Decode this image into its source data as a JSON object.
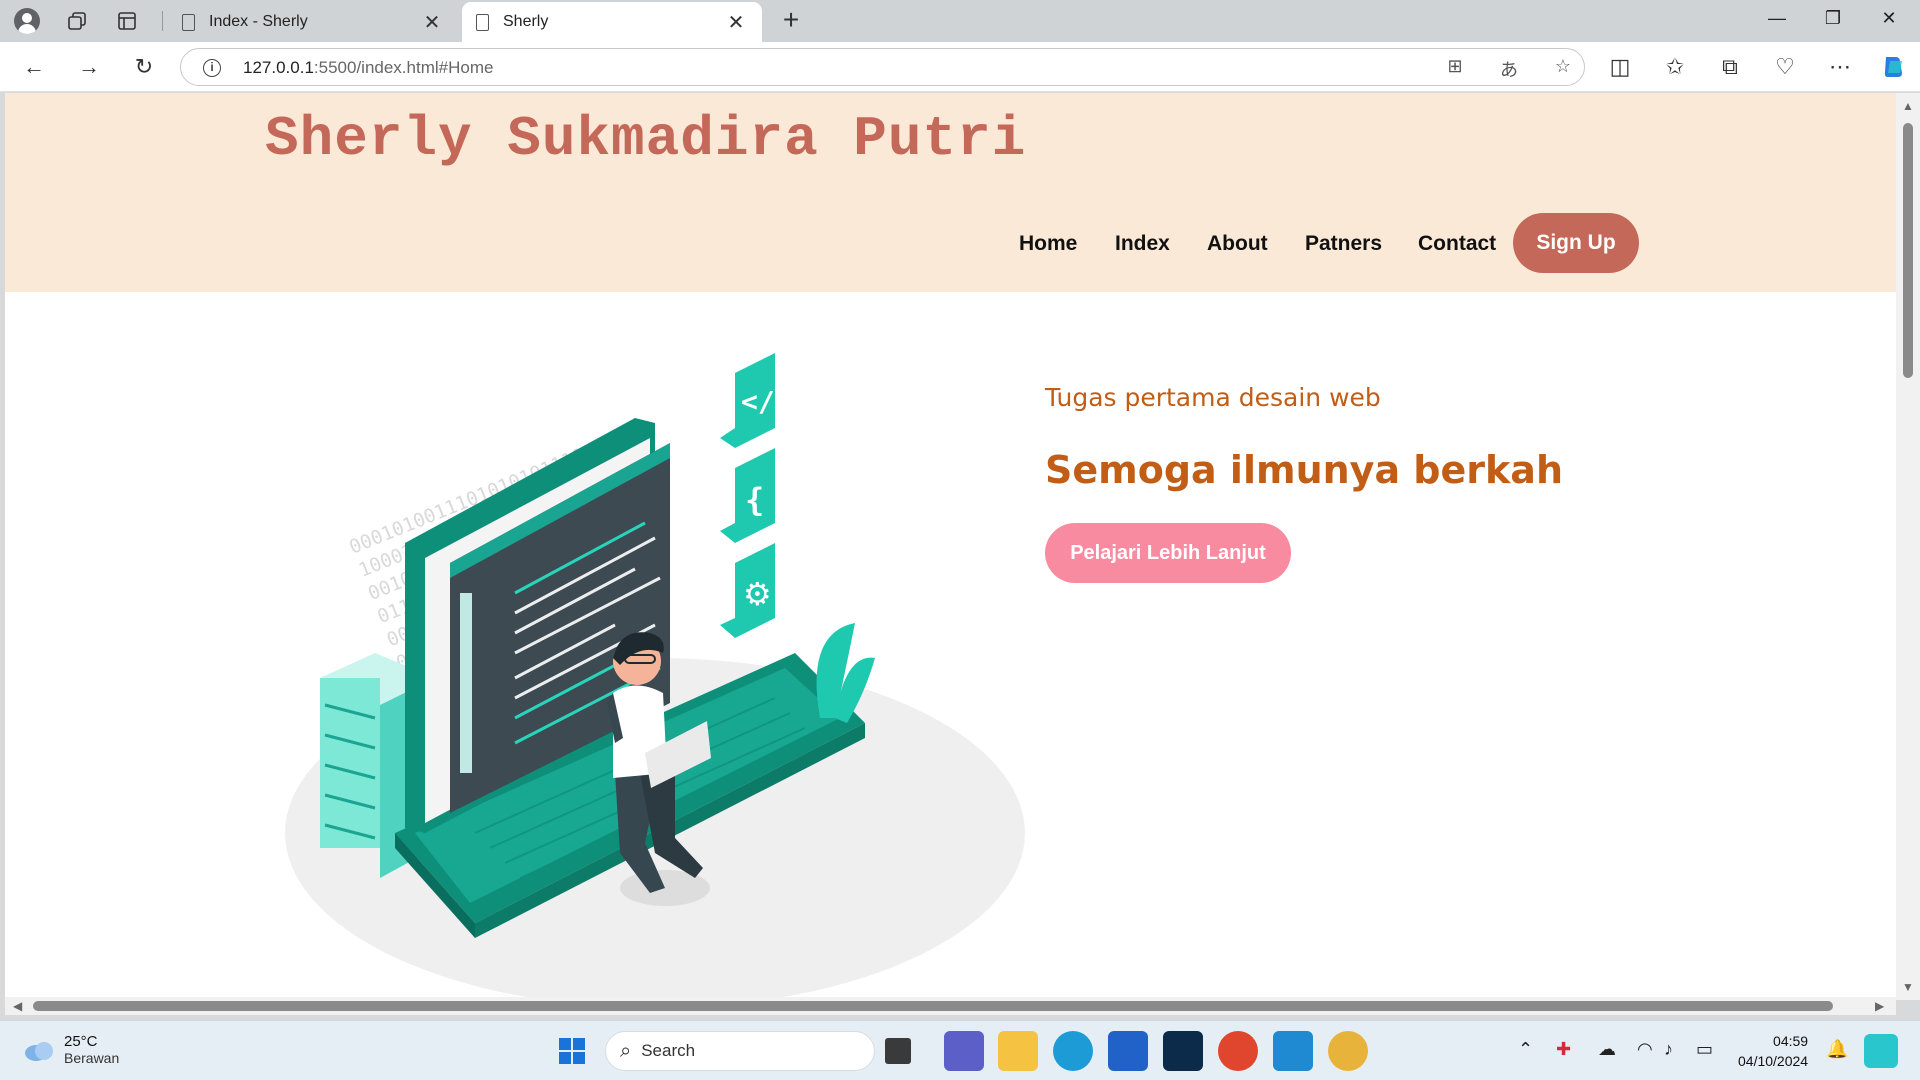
{
  "browser": {
    "tabs": [
      {
        "title": "Index - Sherly",
        "active": false
      },
      {
        "title": "Sherly",
        "active": true
      }
    ],
    "url_host": "127.0.0.1",
    "url_rest": ":5500/index.html#Home",
    "new_tab_icon": "plus-icon",
    "window_controls": [
      "minimize-icon",
      "restore-icon",
      "close-icon"
    ]
  },
  "site": {
    "title": "Sherly Sukmadira Putri",
    "nav": [
      "Home",
      "Index",
      "About",
      "Patners",
      "Contact"
    ],
    "signup": "Sign Up",
    "tagline_small": "Tugas pertama desain web",
    "tagline_big": "Semoga ilmunya berkah",
    "cta": "Pelajari Lebih Lanjut",
    "colors": {
      "header_bg": "#fae9d6",
      "title": "#c4695a",
      "accent": "#c25d16",
      "cta": "#f98ba0",
      "teal": "#1aa592"
    }
  },
  "taskbar": {
    "weather_temp": "25°C",
    "weather_cond": "Berawan",
    "search": "Search",
    "time": "04:59",
    "date": "04/10/2024"
  }
}
